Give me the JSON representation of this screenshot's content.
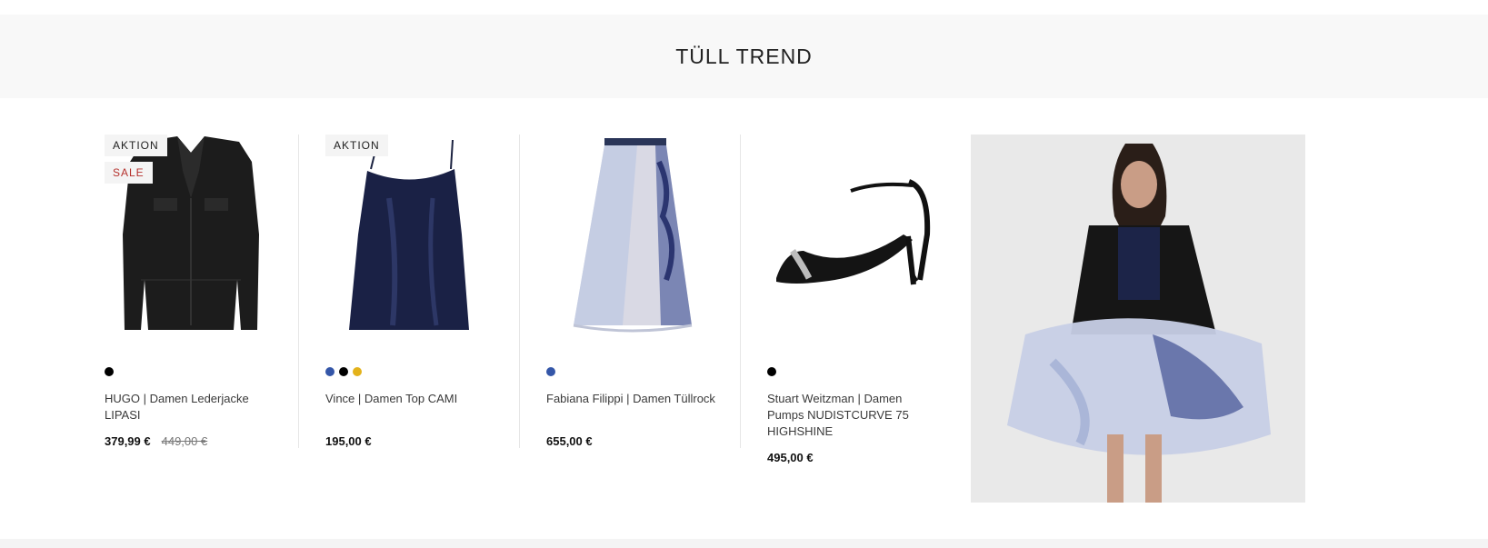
{
  "section": {
    "title": "TÜLL TREND"
  },
  "products": [
    {
      "badges": [
        "AKTION",
        "SALE"
      ],
      "swatches": [
        "#000000"
      ],
      "brand_line": "HUGO  |  Damen Lederjacke LIPASI",
      "price": "379,99 €",
      "old_price": "449,00 €"
    },
    {
      "badges": [
        "AKTION"
      ],
      "swatches": [
        "#3456a8",
        "#000000",
        "#e3b21b"
      ],
      "brand_line": "Vince  |  Damen Top CAMI",
      "price": "195,00 €",
      "old_price": ""
    },
    {
      "badges": [],
      "swatches": [
        "#3456a8"
      ],
      "brand_line": "Fabiana Filippi  |  Damen Tüllrock",
      "price": "655,00 €",
      "old_price": ""
    },
    {
      "badges": [],
      "swatches": [
        "#000000"
      ],
      "brand_line": "Stuart Weitzman  |  Damen Pumps NUDISTCURVE 75 HIGHSHINE",
      "price": "495,00 €",
      "old_price": ""
    }
  ],
  "colors": {
    "sale": "#b5312d",
    "hero_bg": "#f8f8f8",
    "badge_bg": "#f4f4f4"
  }
}
